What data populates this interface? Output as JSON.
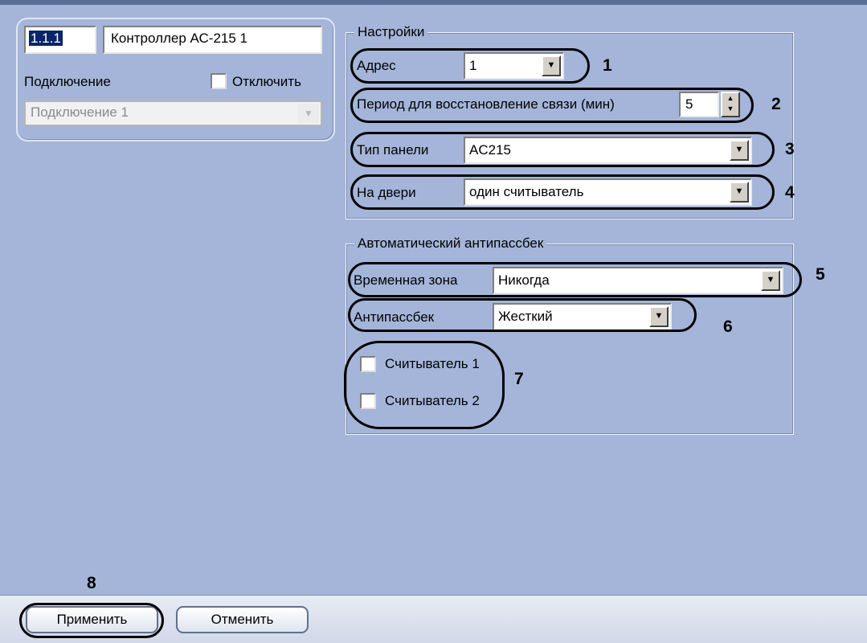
{
  "object": {
    "id": "1.1.1",
    "name": "Контроллер АС-215 1",
    "connection_label": "Подключение",
    "disable_label": "Отключить",
    "connection_value": "Подключение 1"
  },
  "settings": {
    "title": "Настройки",
    "address_label": "Адрес",
    "address_value": "1",
    "period_label": "Период для восстановление связи (мин)",
    "period_value": "5",
    "panel_type_label": "Тип панели",
    "panel_type_value": "AC215",
    "door_label": "На двери",
    "door_value": "один считыватель"
  },
  "antipassback": {
    "title": "Автоматический антипассбек",
    "time_zone_label": "Временная зона",
    "time_zone_value": "Никогда",
    "mode_label": "Антипассбек",
    "mode_value": "Жесткий",
    "reader1_label": "Считыватель 1",
    "reader2_label": "Считыватель 2"
  },
  "buttons": {
    "apply": "Применить",
    "cancel": "Отменить"
  },
  "callouts": [
    "1",
    "2",
    "3",
    "4",
    "5",
    "6",
    "7",
    "8"
  ],
  "colors": {
    "background": "#a4b5d9",
    "selection": "#0a246a"
  },
  "icons": {
    "dropdown": "chevron-down-icon",
    "spinner": "spin-updown-icon"
  }
}
